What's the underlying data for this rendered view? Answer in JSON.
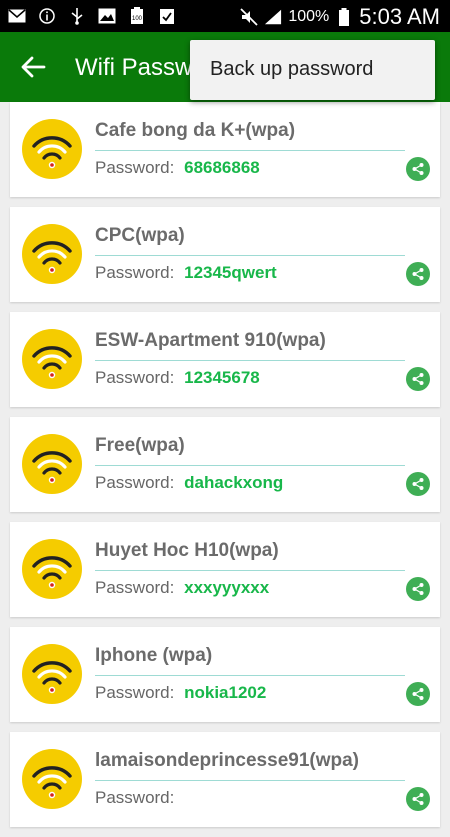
{
  "status_bar": {
    "battery_percent": "100%",
    "time": "5:03 AM",
    "icons": [
      "mail-icon",
      "info-icon",
      "usb-icon",
      "image-icon",
      "battery-100-icon",
      "clipboard-check-icon"
    ]
  },
  "app_bar": {
    "title": "Wifi Passw"
  },
  "overflow_menu": {
    "items": [
      "Back up password"
    ]
  },
  "networks": [
    {
      "name": "Cafe bong da K+(wpa)",
      "password_label": "Password:",
      "password": "68686868"
    },
    {
      "name": "CPC(wpa)",
      "password_label": "Password:",
      "password": "12345qwert"
    },
    {
      "name": "ESW-Apartment 910(wpa)",
      "password_label": "Password:",
      "password": "12345678"
    },
    {
      "name": "Free(wpa)",
      "password_label": "Password:",
      "password": "dahackxong"
    },
    {
      "name": "Huyet Hoc H10(wpa)",
      "password_label": "Password:",
      "password": "xxxyyyxxx"
    },
    {
      "name": "Iphone (wpa)",
      "password_label": "Password:",
      "password": "nokia1202"
    },
    {
      "name": "lamaisondeprincesse91(wpa)",
      "password_label": "Password:",
      "password": ""
    }
  ],
  "colors": {
    "app_bar": "#0a7a0a",
    "password": "#18b74a",
    "wifi_icon_bg": "#f5cc00",
    "share": "#3fae55"
  }
}
